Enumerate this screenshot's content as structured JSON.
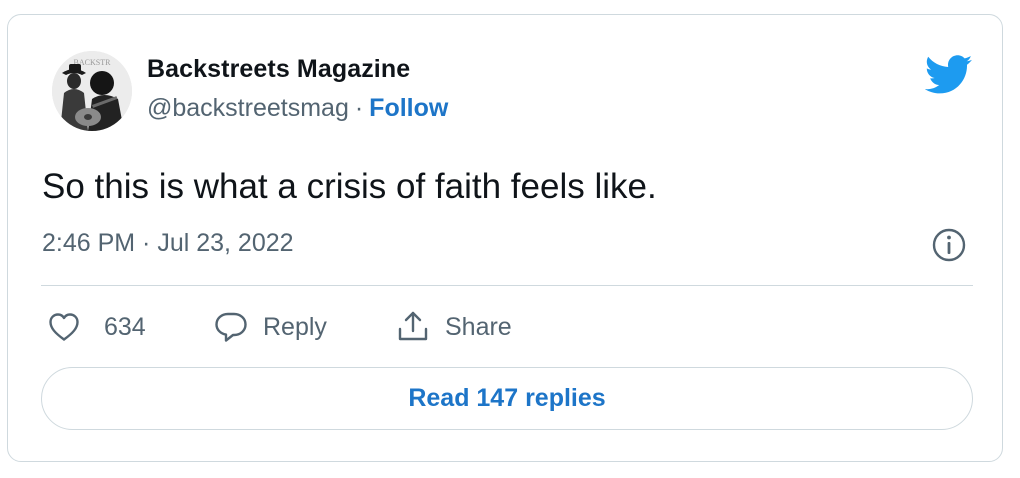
{
  "author": {
    "name": "Backstreets Magazine",
    "handle": "@backstreetsmag",
    "separator": "·",
    "follow_label": "Follow",
    "avatar_text": "BACKSTR"
  },
  "tweet": {
    "text": "So this is what a crisis of faith feels like.",
    "timestamp": "2:46 PM · Jul 23, 2022"
  },
  "actions": {
    "like_count": "634",
    "reply_label": "Reply",
    "share_label": "Share"
  },
  "footer": {
    "read_replies_label": "Read 147 replies"
  },
  "icons": {
    "brand": "twitter-bird-icon",
    "info": "info-icon",
    "like": "heart-icon",
    "reply": "speech-bubble-icon",
    "share": "share-upload-icon"
  },
  "colors": {
    "brand_blue": "#1d9bf0",
    "link_blue": "#1d75c8",
    "secondary_text": "#536471",
    "border": "#cfd9de"
  }
}
